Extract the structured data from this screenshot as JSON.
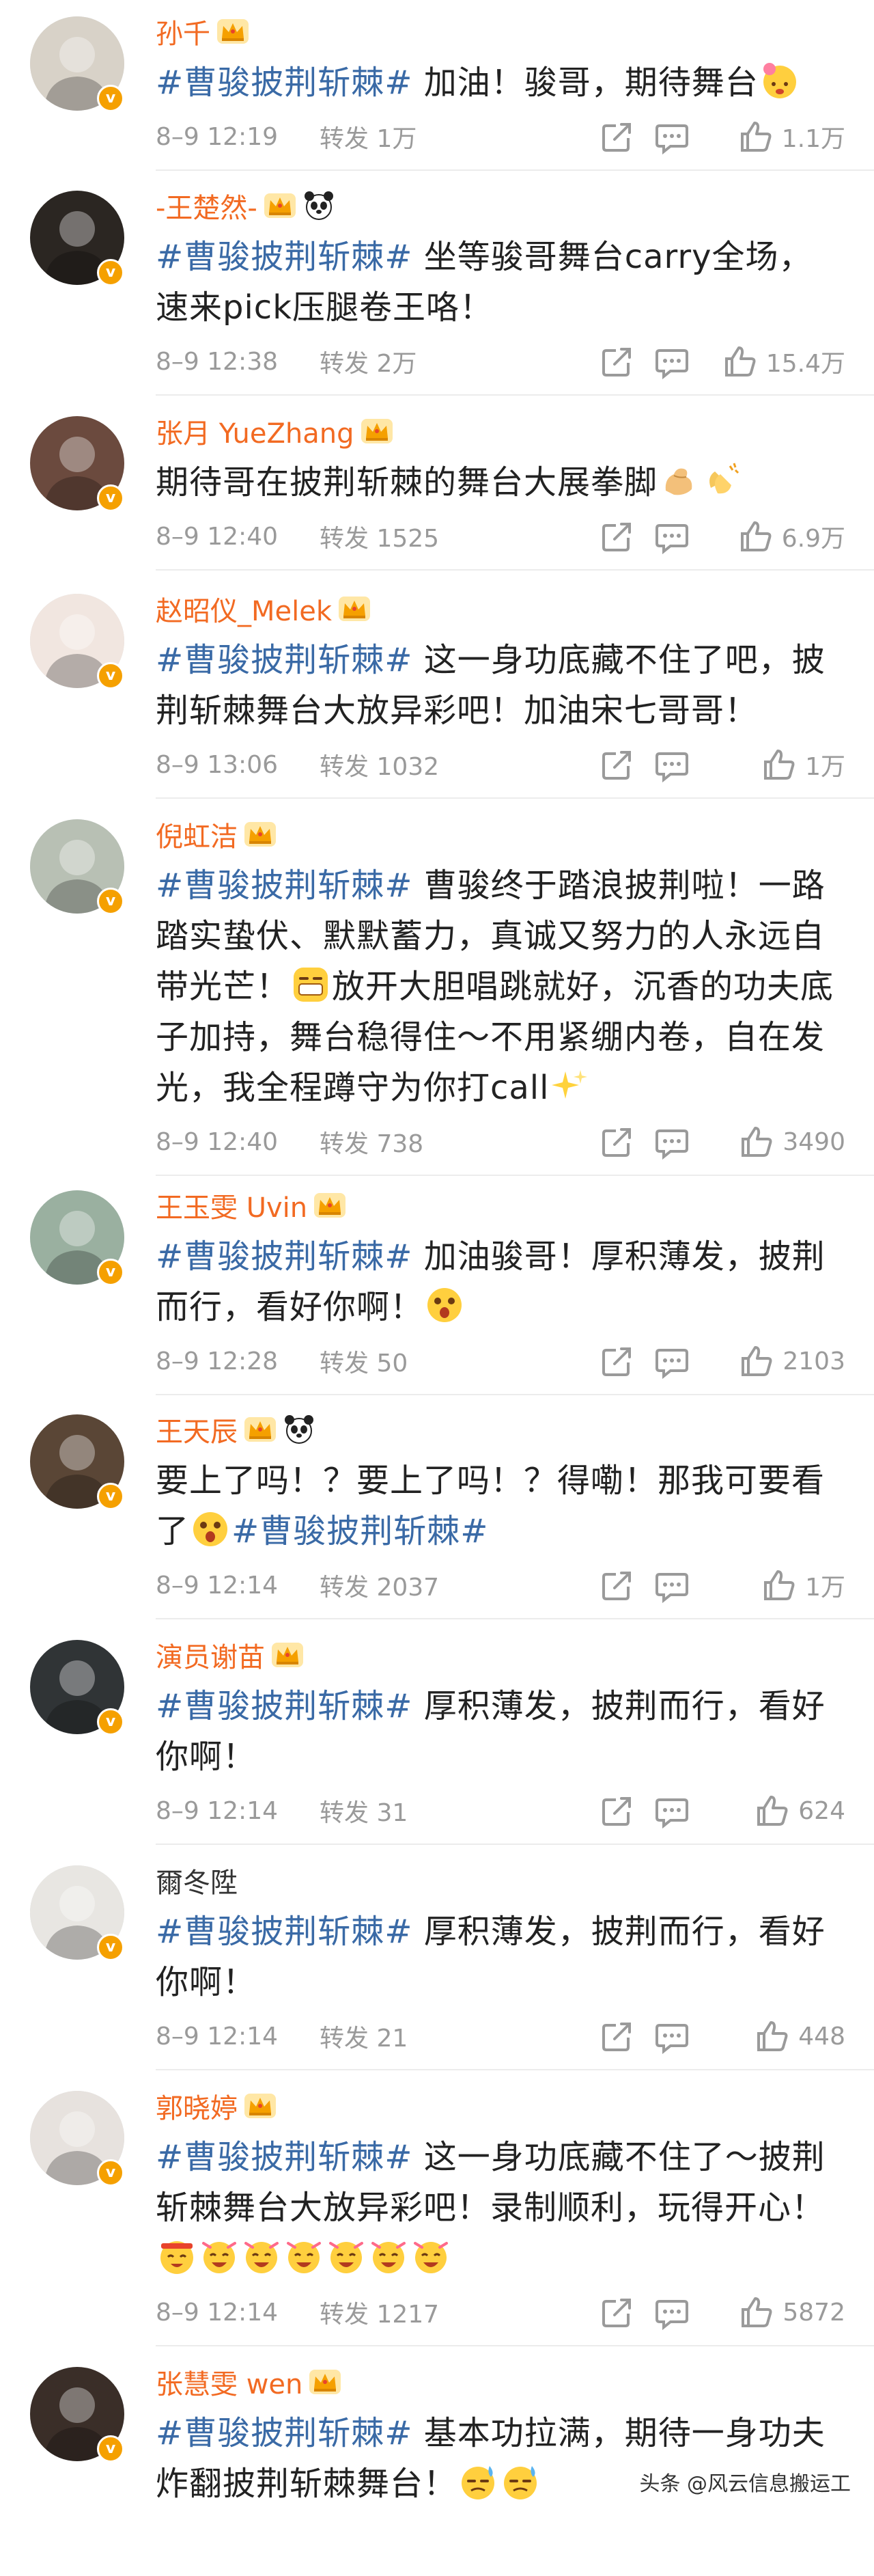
{
  "repost_label": "转发",
  "colors": {
    "name": "#f26a22",
    "hashtag": "#3a6aa6",
    "meta": "#9a9a9a",
    "badge": "#f5a000"
  },
  "posts": [
    {
      "name": "孙千",
      "badges": [
        "crown"
      ],
      "pre": "",
      "hashtag": "#曹骏披荆斩棘#",
      "body": " 加油！骏哥，期待舞台",
      "emojis": [
        "flower-face"
      ],
      "time": "8–9 12:19",
      "reposts": "1万",
      "likes": "1.1万",
      "avatar_color": "#d8d2c8"
    },
    {
      "name": "-王楚然-",
      "badges": [
        "crown",
        "panda"
      ],
      "pre": "",
      "hashtag": "#曹骏披荆斩棘#",
      "body": " 坐等骏哥舞台carry全场，速来pick压腿卷王咯！",
      "emojis": [],
      "time": "8–9 12:38",
      "reposts": "2万",
      "likes": "15.4万",
      "avatar_color": "#2b2622"
    },
    {
      "name": "张月 YueZhang",
      "badges": [
        "crown"
      ],
      "pre": "期待哥在披荆斩棘的舞台大展拳脚",
      "hashtag": "",
      "body": "",
      "emojis": [
        "muscle",
        "clap"
      ],
      "time": "8–9 12:40",
      "reposts": "1525",
      "likes": "6.9万",
      "avatar_color": "#6b4a3e"
    },
    {
      "name": "赵昭仪_Melek",
      "badges": [
        "crown"
      ],
      "pre": "",
      "hashtag": "#曹骏披荆斩棘#",
      "body": " 这一身功底藏不住了吧，披荆斩棘舞台大放异彩吧！加油宋七哥哥！",
      "emojis": [],
      "time": "8–9 13:06",
      "reposts": "1032",
      "likes": "1万",
      "avatar_color": "#f1e6e0"
    },
    {
      "name": "倪虹洁",
      "badges": [
        "crown"
      ],
      "pre": "",
      "hashtag": "#曹骏披荆斩棘#",
      "body": " 曹骏终于踏浪披荆啦！一路踏实蛰伏、默默蓄力，真诚又努力的人永远自带光芒！",
      "emojis": [
        "grin"
      ],
      "body2": "放开大胆唱跳就好，沉香的功夫底子加持，舞台稳得住～不用紧绷内卷，自在发光，我全程蹲守为你打call",
      "emojis2": [
        "sparkles"
      ],
      "time": "8–9 12:40",
      "reposts": "738",
      "likes": "3490",
      "avatar_color": "#b8c0b4"
    },
    {
      "name": "王玉雯 Uvin",
      "badges": [
        "crown"
      ],
      "pre": "",
      "hashtag": "#曹骏披荆斩棘#",
      "body": " 加油骏哥！厚积薄发，披荆而行，看好你啊！",
      "emojis": [
        "wow"
      ],
      "time": "8–9 12:28",
      "reposts": "50",
      "likes": "2103",
      "avatar_color": "#9ab0a0"
    },
    {
      "name": "王天辰",
      "badges": [
        "crown",
        "panda"
      ],
      "pre": "要上了吗！？要上了吗！？得嘞！那我可要看了",
      "hashtag": "#曹骏披荆斩棘#",
      "body": "",
      "emojis": [
        "wow"
      ],
      "time": "8–9 12:14",
      "reposts": "2037",
      "likes": "1万",
      "avatar_color": "#5a4636"
    },
    {
      "name": "演员谢苗",
      "badges": [
        "crown"
      ],
      "pre": "",
      "hashtag": "#曹骏披荆斩棘#",
      "body": " 厚积薄发，披荆而行，看好你啊！",
      "emojis": [],
      "time": "8–9 12:14",
      "reposts": "31",
      "likes": "624",
      "avatar_color": "#303436"
    },
    {
      "name": "爾冬陞",
      "badges": [],
      "pre": "",
      "hashtag": "#曹骏披荆斩棘#",
      "body": " 厚积薄发，披荆而行，看好你啊！",
      "emojis": [],
      "time": "8–9 12:14",
      "reposts": "21",
      "likes": "448",
      "avatar_color": "#e8e6e2"
    },
    {
      "name": "郭晓婷",
      "badges": [
        "crown"
      ],
      "pre": "",
      "hashtag": "#曹骏披荆斩棘#",
      "body": " 这一身功底藏不住了～披荆斩棘舞台大放异彩吧！录制顺利，玩得开心！",
      "emojis": [
        "cheer",
        "party",
        "party",
        "party",
        "party",
        "party",
        "party"
      ],
      "time": "8–9 12:14",
      "reposts": "1217",
      "likes": "5872",
      "avatar_color": "#e7e2de"
    },
    {
      "name": "张慧雯 wen",
      "badges": [
        "crown"
      ],
      "pre": "",
      "hashtag": "#曹骏披荆斩棘#",
      "body": " 基本功拉满，期待一身功夫炸翻披荆斩棘舞台！",
      "emojis": [
        "sweat",
        "sweat"
      ],
      "time": "",
      "reposts": "",
      "likes": "",
      "avatar_color": "#3a2e28"
    }
  ],
  "watermark": "头条 @风云信息搬运工"
}
